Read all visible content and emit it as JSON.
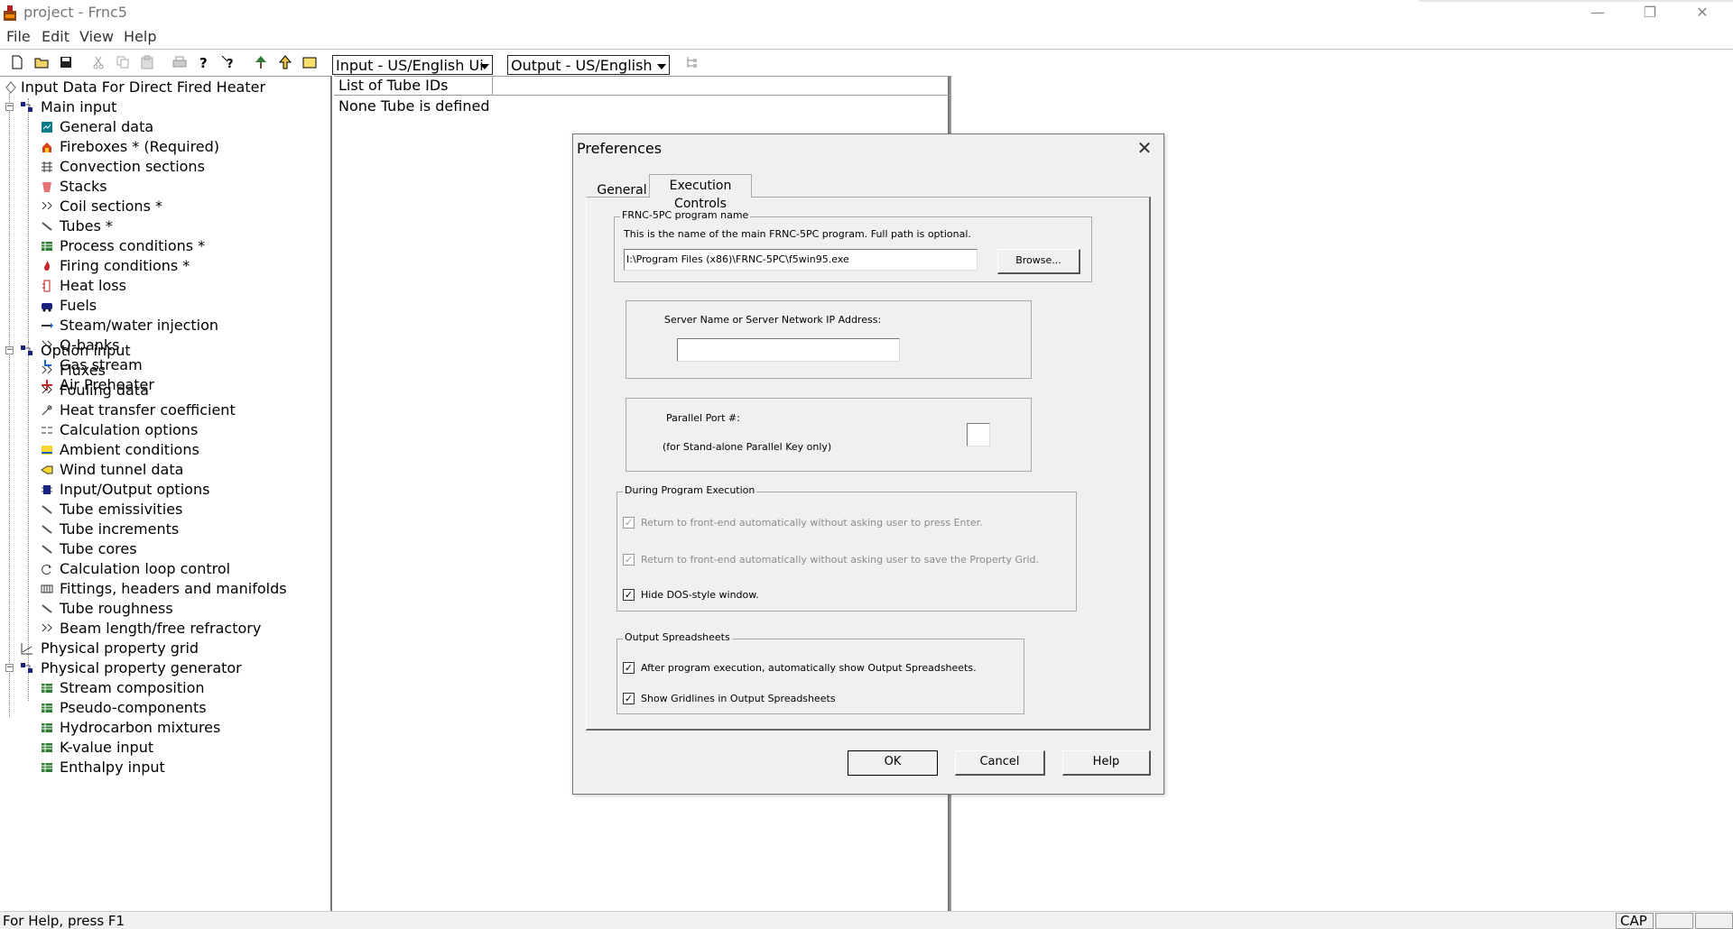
{
  "window": {
    "title": "project - Frnc5",
    "minimize": "—",
    "restore": "❐",
    "close": "✕"
  },
  "menu": [
    "File",
    "Edit",
    "View",
    "Help"
  ],
  "toolbar": {
    "input_units": "Input - US/English Ui",
    "output_units": "Output - US/English"
  },
  "tree": {
    "root": "Input Data For Direct Fired Heater",
    "main_input": {
      "label": "Main input",
      "items": [
        "General data",
        "Fireboxes * (Required)",
        "Convection sections",
        "Stacks",
        "Coil sections *",
        "Tubes *",
        "Process conditions *",
        "Firing conditions *",
        "Heat loss",
        "Fuels",
        "Steam/water injection",
        "Q-banks",
        "Gas stream",
        "Air Preheater"
      ]
    },
    "option_input": {
      "label": "Option input",
      "items": [
        "Fluxes",
        "Fouling data",
        "Heat transfer coefficient",
        "Calculation options",
        "Ambient conditions",
        "Wind tunnel data",
        "Input/Output options",
        "Tube emissivities",
        "Tube increments",
        "Tube cores",
        "Calculation loop control",
        "Fittings, headers and manifolds",
        "Tube roughness",
        "Beam length/free refractory"
      ]
    },
    "physical_property_grid": "Physical property grid",
    "generator": {
      "label": "Physical property generator",
      "items": [
        "Stream composition",
        "Pseudo-components",
        "Hydrocarbon mixtures",
        "K-value input",
        "Enthalpy input"
      ]
    }
  },
  "middle": {
    "header": "List of Tube IDs",
    "text": "None Tube  is defined"
  },
  "status": {
    "text": "For Help, press F1",
    "cap": "CAP"
  },
  "dialog": {
    "title": "Preferences",
    "close": "✕",
    "tabs": [
      "General",
      "Execution Controls"
    ],
    "program": {
      "group": "FRNC-5PC program name",
      "desc": "This is the name of the main FRNC-5PC program. Full path is optional.",
      "path": "I:\\Program Files (x86)\\FRNC-5PC\\f5win95.exe",
      "browse": "Browse..."
    },
    "server": {
      "label": "Server Name or Server Network IP Address:",
      "value": ""
    },
    "parallel": {
      "label": "Parallel Port #:",
      "note": "(for Stand-alone Parallel Key only)",
      "value": ""
    },
    "execution": {
      "group": "During Program Execution",
      "opt1": "Return to front-end automatically without asking user to press Enter.",
      "opt2": "Return to front-end automatically without asking user to save the Property Grid.",
      "opt3": "Hide DOS-style window."
    },
    "spreadsheets": {
      "group": "Output Spreadsheets",
      "opt1": "After program execution, automatically show Output Spreadsheets.",
      "opt2": "Show Gridlines in Output Spreadsheets"
    },
    "buttons": {
      "ok": "OK",
      "cancel": "Cancel",
      "help": "Help"
    },
    "check": "✓"
  }
}
